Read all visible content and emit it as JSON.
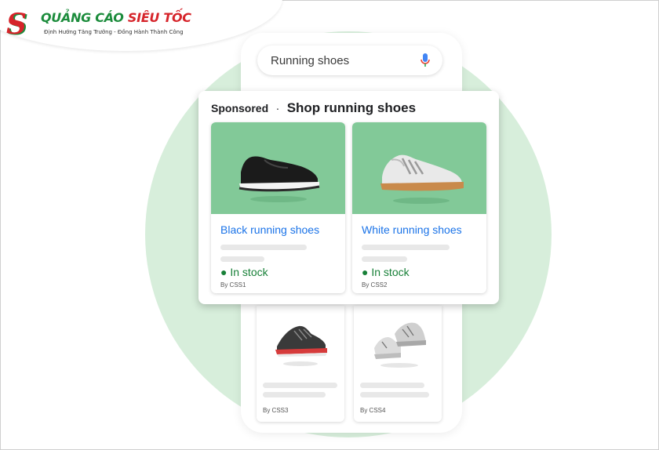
{
  "brand": {
    "title_green": "QUẢNG CÁO",
    "title_red": "SIÊU TỐC",
    "tagline": "Định Hướng Tăng Trưởng - Đồng Hành Thành Công"
  },
  "search": {
    "query": "Running shoes",
    "mic_icon": "microphone-icon"
  },
  "sponsored": {
    "label": "Sponsored",
    "separator": "·",
    "title": "Shop running shoes",
    "products": [
      {
        "name": "Black running shoes",
        "stock": "In stock",
        "seller": "By CSS1"
      },
      {
        "name": "White running shoes",
        "stock": "In stock",
        "seller": "By CSS2"
      }
    ]
  },
  "organic": {
    "products": [
      {
        "seller": "By CSS3"
      },
      {
        "seller": "By CSS4"
      }
    ]
  },
  "colors": {
    "accent_green": "#82c998",
    "link_blue": "#1a73e8",
    "stock_green": "#188038",
    "brand_red": "#d6242a",
    "brand_green": "#1c8c3c"
  }
}
